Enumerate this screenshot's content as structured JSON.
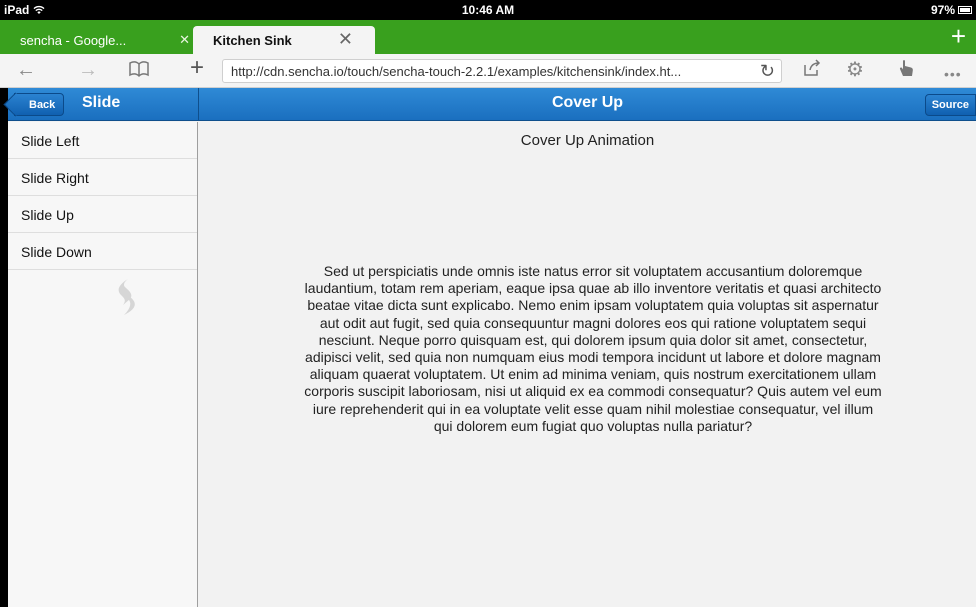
{
  "status_bar": {
    "carrier": "iPad",
    "time": "10:46 AM",
    "battery": "97%"
  },
  "tabs": [
    {
      "label": "sencha - Google...",
      "active": false
    },
    {
      "label": "Kitchen Sink",
      "active": true
    }
  ],
  "toolbar": {
    "url": "http://cdn.sencha.io/touch/sencha-touch-2.2.1/examples/kitchensink/index.ht..."
  },
  "app": {
    "back_label": "Back",
    "nav_title": "Slide",
    "main_title": "Cover Up",
    "source_label": "Source",
    "list_items": [
      "Slide Left",
      "Slide Right",
      "Slide Up",
      "Slide Down"
    ],
    "content_heading": "Cover Up Animation",
    "content_body": "Sed ut perspiciatis unde omnis iste natus error sit voluptatem accusantium doloremque laudantium, totam rem aperiam, eaque ipsa quae ab illo inventore veritatis et quasi architecto beatae vitae dicta sunt explicabo. Nemo enim ipsam voluptatem quia voluptas sit aspernatur aut odit aut fugit, sed quia consequuntur magni dolores eos qui ratione voluptatem sequi nesciunt. Neque porro quisquam est, qui dolorem ipsum quia dolor sit amet, consectetur, adipisci velit, sed quia non numquam eius modi tempora incidunt ut labore et dolore magnam aliquam quaerat voluptatem. Ut enim ad minima veniam, quis nostrum exercitationem ullam corporis suscipit laboriosam, nisi ut aliquid ex ea commodi consequatur? Quis autem vel eum iure reprehenderit qui in ea voluptate velit esse quam nihil molestiae consequatur, vel illum qui dolorem eum fugiat quo voluptas nulla pariatur?"
  },
  "colors": {
    "tab_bar": "#39a01e",
    "header": "#1a6fbf"
  }
}
